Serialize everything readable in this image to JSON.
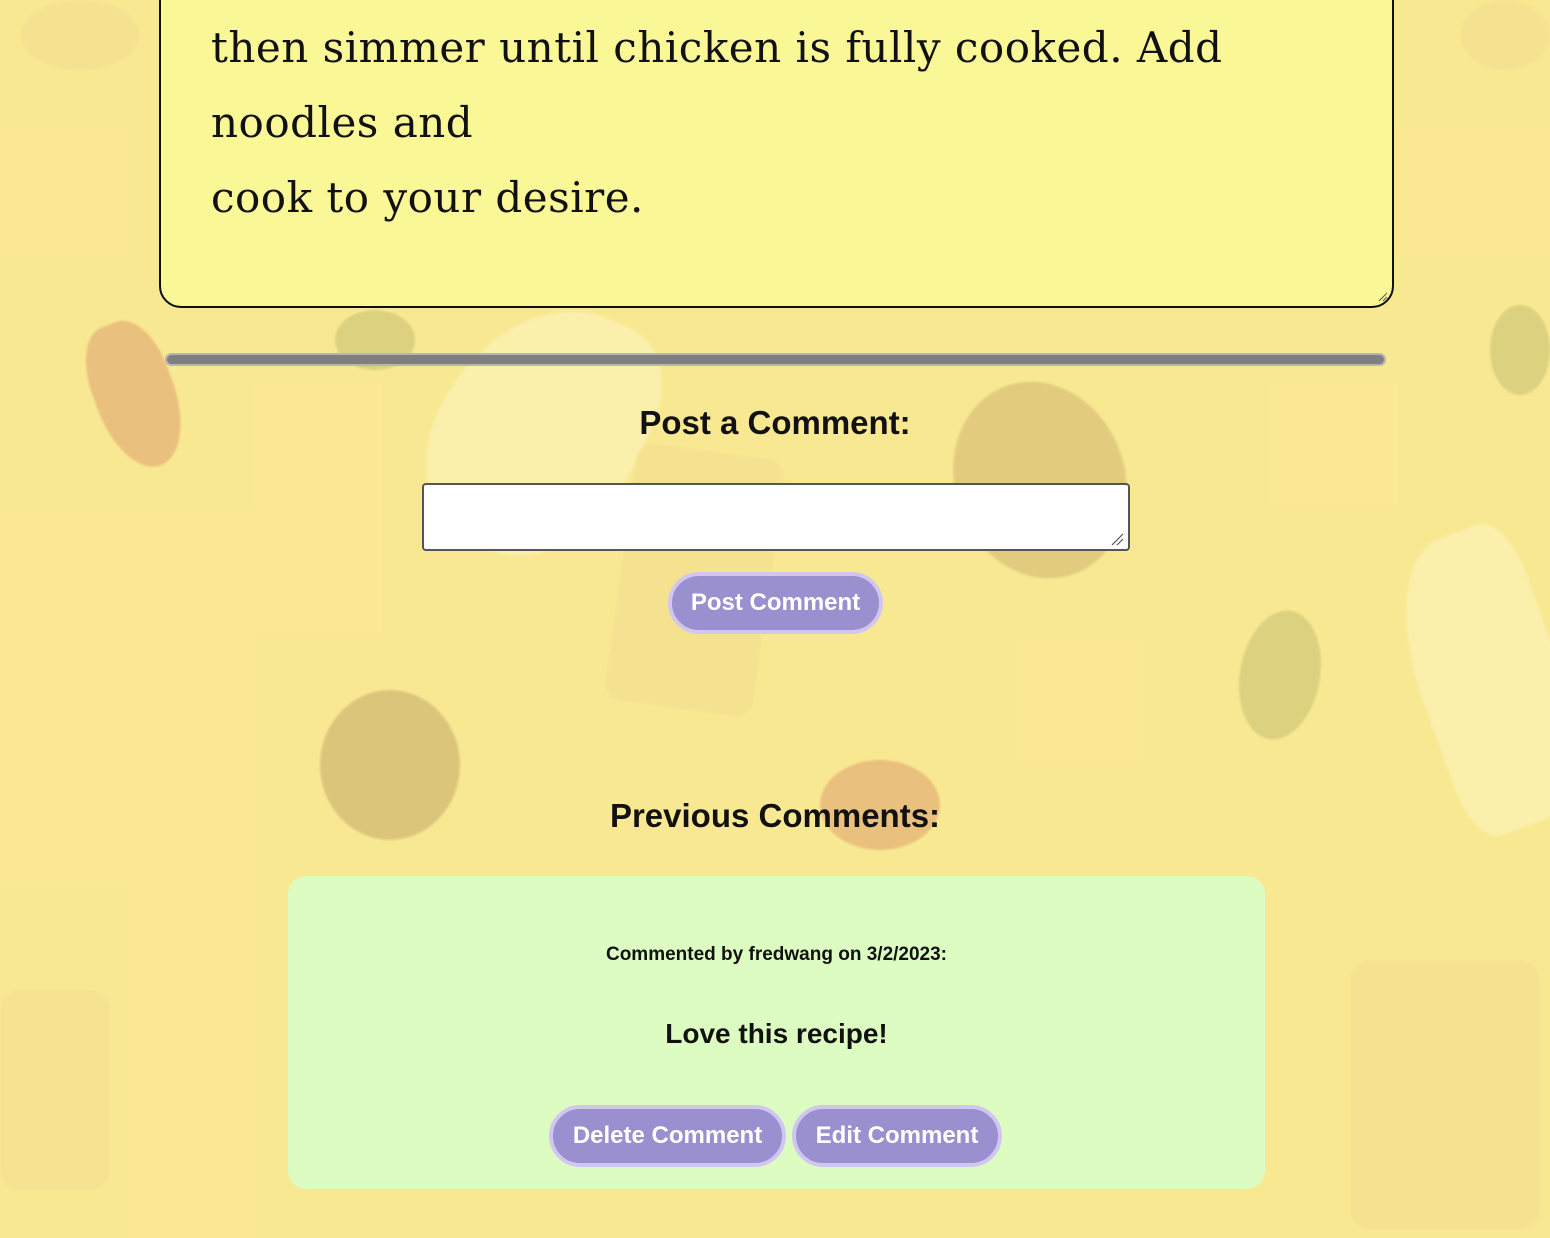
{
  "recipe": {
    "instructions_lines": [
      "then simmer until chicken is fully cooked. Add noodles and",
      "cook to your desire."
    ]
  },
  "post_section": {
    "heading": "Post a Comment:",
    "input_value": "",
    "button_label": "Post Comment"
  },
  "previous_section": {
    "heading": "Previous Comments:",
    "comments": [
      {
        "meta": "Commented by fredwang on 3/2/2023:",
        "text": "Love this recipe!",
        "delete_label": "Delete Comment",
        "edit_label": "Edit Comment"
      }
    ]
  },
  "colors": {
    "background": "#f7e38f",
    "note": "#faf797",
    "button": "#9a8fcf",
    "button_border": "#d0c6ef",
    "comment_card": "#dcfcc2",
    "divider": "#7f7f7f"
  }
}
